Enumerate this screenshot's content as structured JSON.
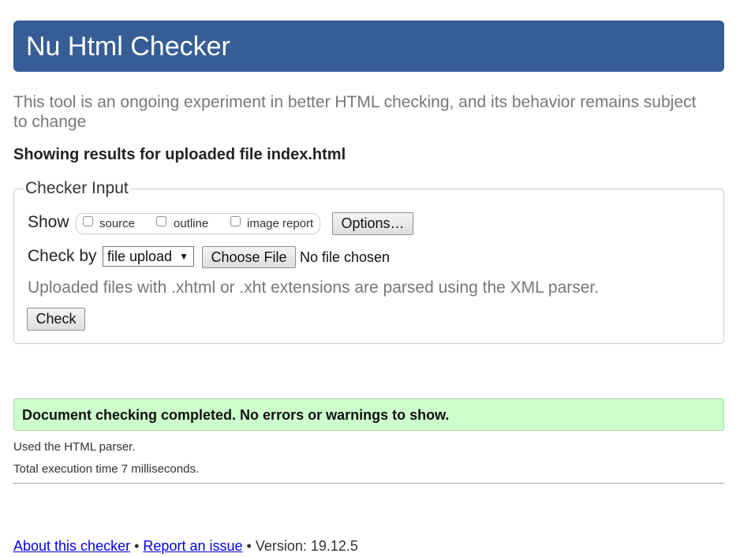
{
  "header": {
    "title": "Nu Html Checker"
  },
  "intro": "This tool is an ongoing experiment in better HTML checking, and its behavior remains subject to change",
  "results_heading": "Showing results for uploaded file index.html",
  "checker": {
    "legend": "Checker Input",
    "show_label": "Show",
    "show_options": [
      {
        "label": "source",
        "checked": false
      },
      {
        "label": "outline",
        "checked": false
      },
      {
        "label": "image report",
        "checked": false
      }
    ],
    "options_button": "Options…",
    "check_by_label": "Check by",
    "check_by_value": "file upload",
    "choose_file_button": "Choose File",
    "file_status": "No file chosen",
    "xml_note": "Uploaded files with .xhtml or .xht extensions are parsed using the XML parser.",
    "check_button": "Check"
  },
  "result": {
    "message": "Document checking completed. No errors or warnings to show.",
    "parser_info": "Used the HTML parser.",
    "execution_time": "Total execution time 7 milliseconds."
  },
  "footer": {
    "about_link": "About this checker",
    "separator": "•",
    "report_link": "Report an issue",
    "version_text": "Version: 19.12.5"
  },
  "colors": {
    "header_bg": "#365d95",
    "success_bg": "#ccffcc",
    "muted_text": "#777777",
    "link": "#0000ee"
  }
}
